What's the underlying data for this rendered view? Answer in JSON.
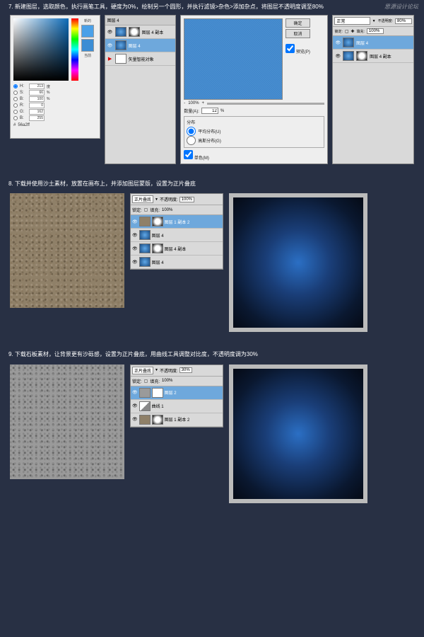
{
  "watermark": "思源设计论坛",
  "step7": {
    "text": "7. 新建图层，选取颜色，执行画笔工具，硬度为0%，绘制另一个圆形，并执行滤镜>杂色>添加杂点，将图层不透明度调至80%",
    "picker": {
      "newLabel": "新的",
      "curLabel": "当前",
      "h": {
        "l": "H:",
        "v": "213",
        "u": "度"
      },
      "s": {
        "l": "S:",
        "v": "66",
        "u": "%"
      },
      "b": {
        "l": "B:",
        "v": "100",
        "u": "%"
      },
      "r": {
        "l": "R:",
        "v": "0"
      },
      "g": {
        "l": "G:",
        "v": "162"
      },
      "bl": {
        "l": "B:",
        "v": "255"
      },
      "hex": {
        "l": "#",
        "v": "56a2ff"
      }
    },
    "layersA": {
      "hdr": "图层 4",
      "r1": "图层 4 副本",
      "r2": "图层 4",
      "r3": "矢量智能对象"
    },
    "noise": {
      "ok": "确定",
      "cancel": "取消",
      "preview": "预览(P)",
      "zl": "-",
      "zpct": "100%",
      "zr": "+",
      "amtL": "数量(A):",
      "amtV": "12",
      "amtU": "%",
      "distTitle": "分布",
      "d1": "平均分布(U)",
      "d2": "高斯分布(G)",
      "mono": "单色(M)"
    },
    "layersB": {
      "blend": "正常",
      "opL": "不透明度:",
      "opV": "80%",
      "lockL": "锁定:",
      "fillL": "填充:",
      "fillV": "100%",
      "r1": "图层 4",
      "r2": "图层 4 副本"
    }
  },
  "step8": {
    "text": "8. 下载并使用沙土素材，放置在画布上，并添加图层蒙版，设置为正片叠底",
    "layers": {
      "blend": "正片叠底",
      "opL": "不透明度:",
      "opV": "100%",
      "lockL": "锁定:",
      "fillL": "填充:",
      "fillV": "100%",
      "r1": "图层 1 副本 2",
      "r2": "图层 4",
      "r3": "图层 4 副本",
      "r4": "图层 4"
    }
  },
  "step9": {
    "text": "9. 下载石板素材，让背景更有沙砾感，设置为正片叠底，用曲线工具调整对比度，不透明度调为30%",
    "layers": {
      "blend": "正片叠底",
      "opL": "不透明度:",
      "opV": "30%",
      "lockL": "锁定:",
      "fillL": "填充:",
      "fillV": "100%",
      "r1": "图层 2",
      "r2": "曲线 1",
      "r3": "图层 1 副本 2"
    }
  }
}
